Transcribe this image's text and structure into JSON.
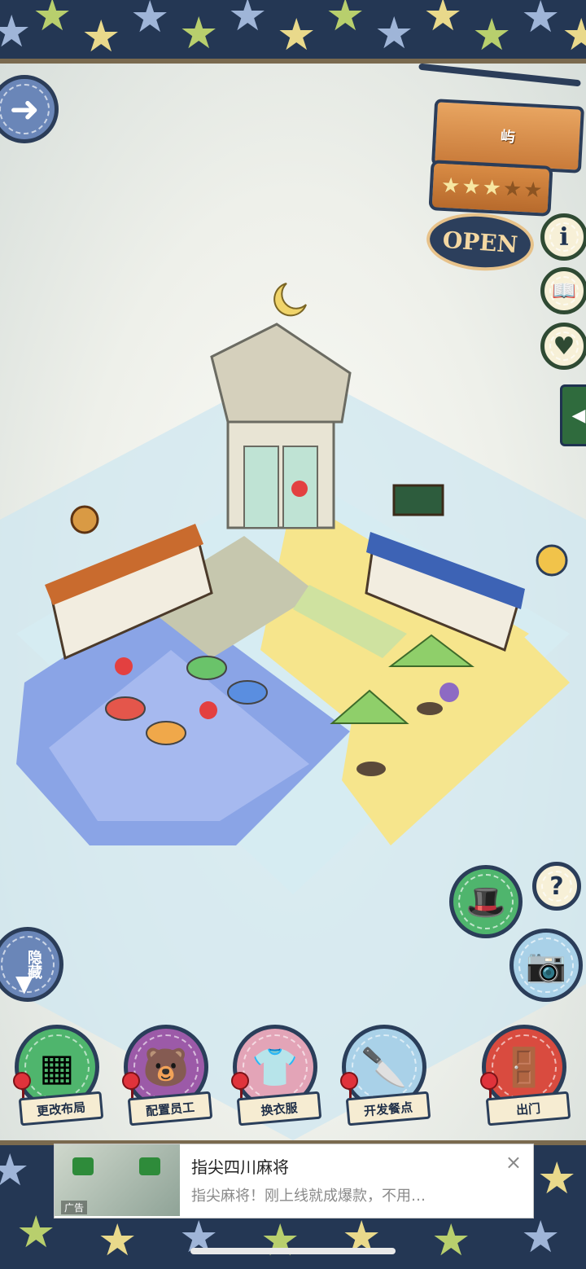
{
  "colors": {
    "border_navy": "#243754",
    "water": "#8aa4e6",
    "sand": "#f6e58c",
    "ocean": "#cfe7f0"
  },
  "sign": {
    "name": "屿",
    "rating_filled": 3,
    "rating_total": 5,
    "status": "OPEN"
  },
  "side_buttons": [
    {
      "icon": "info-icon",
      "glyph": "i"
    },
    {
      "icon": "book-icon",
      "glyph": "📖"
    },
    {
      "icon": "heart-bubble-icon",
      "glyph": "♥"
    }
  ],
  "top_left_button": {
    "icon": "arrow-right-icon"
  },
  "hide_button": {
    "label": "隐藏"
  },
  "help_button": {
    "glyph": "?"
  },
  "actions": [
    {
      "label": "更改布局",
      "icon": "table-icon",
      "color": "#4fb56d"
    },
    {
      "label": "配置员工",
      "icon": "bear-icon",
      "color": "#9c5aa8"
    },
    {
      "label": "换衣服",
      "icon": "shirt-icon",
      "color": "#e3a4b7"
    },
    {
      "label": "开发餐点",
      "icon": "knife-icon",
      "color": "#a9d1e8"
    },
    {
      "label": "出门",
      "icon": "door-icon",
      "color": "#d94b3f"
    }
  ],
  "ad": {
    "title": "指尖四川麻将",
    "description": "指尖麻将！刚上线就成爆款，不用…",
    "tag": "广告",
    "close": "×"
  }
}
